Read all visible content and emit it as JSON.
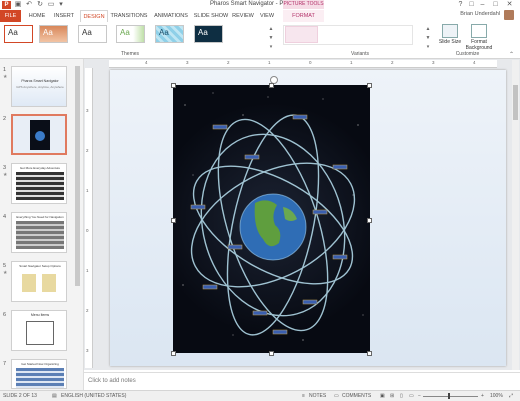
{
  "window": {
    "title": "Pharos Smart Navigator - PowerPoint",
    "contextual_tab_group": "PICTURE TOOLS",
    "user_name": "Brian Underdahl",
    "controls": [
      "?",
      "□",
      "–",
      "□",
      "✕"
    ]
  },
  "tabs": [
    "FILE",
    "HOME",
    "INSERT",
    "DESIGN",
    "TRANSITIONS",
    "ANIMATIONS",
    "SLIDE SHOW",
    "REVIEW",
    "VIEW",
    "FORMAT"
  ],
  "active_tab": "DESIGN",
  "ribbon": {
    "themes": [
      {
        "label": "Aa",
        "bg": "#ffffff",
        "fg": "#333333"
      },
      {
        "label": "Aa",
        "bg": "#e8a070",
        "fg": "#ffffff"
      },
      {
        "label": "Aa",
        "bg": "#ffffff",
        "fg": "#333333"
      },
      {
        "label": "Aa",
        "bg": "#ffffff",
        "fg": "#6aa84f"
      },
      {
        "label": "Aa",
        "bg": "#8fd0e8",
        "fg": "#1c4f6a"
      },
      {
        "label": "Aa",
        "bg": "#0e2e42",
        "fg": "#ffffff"
      }
    ],
    "themes_group_label": "Themes",
    "variants_group_label": "Variants",
    "customize_group_label": "Customize",
    "slide_size_label": "Slide Size",
    "format_background_label": "Format Background"
  },
  "thumbnails": [
    {
      "number": "1",
      "title": "Pharos Smart Navigator",
      "subtitle": "GPS Anywhere, Anytime, Anywhere"
    },
    {
      "number": "2",
      "selected": true
    },
    {
      "number": "3",
      "title": "Get More Everyday Adventure"
    },
    {
      "number": "4",
      "title": "Everything You Need for Navigation"
    },
    {
      "number": "5",
      "title": "Smart Navigator Setup Options"
    },
    {
      "number": "6",
      "title": "Menu Items"
    },
    {
      "number": "7",
      "title": "Get Started Now Organizing"
    }
  ],
  "rulers": {
    "horizontal": [
      "4",
      "3",
      "2",
      "1",
      "0",
      "1",
      "2",
      "3",
      "4"
    ],
    "vertical": [
      "3",
      "2",
      "1",
      "0",
      "1",
      "2",
      "3"
    ]
  },
  "notes_placeholder": "Click to add notes",
  "status": {
    "slide_info": "SLIDE 2 OF 13",
    "language": "ENGLISH (UNITED STATES)",
    "notes_label": "NOTES",
    "comments_label": "COMMENTS",
    "zoom": "100%"
  },
  "colors": {
    "accent": "#d24726",
    "picture_tools": "#b3326a",
    "selected_thumb_border": "#e07a5f"
  }
}
